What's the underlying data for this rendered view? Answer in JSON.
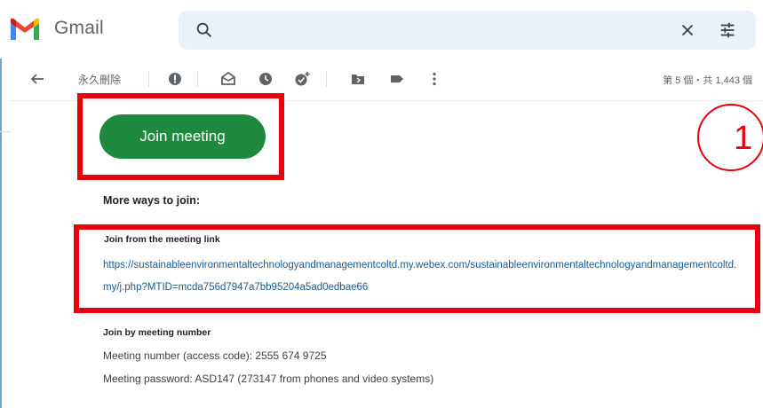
{
  "app": {
    "name": "Gmail"
  },
  "search": {
    "icon": "search-icon",
    "clear_icon": "close-icon",
    "options_icon": "tune-icon"
  },
  "toolbar": {
    "back_icon": "arrow-left-icon",
    "delete_forever_label": "永久刪除",
    "icons": [
      "report-spam-icon",
      "mark-unread-icon",
      "snooze-icon",
      "add-task-icon",
      "move-to-icon",
      "label-icon",
      "more-vert-icon"
    ],
    "count_text": "第 5 個・共 1,443 個"
  },
  "email": {
    "join_button_label": "Join meeting",
    "step_number": "1",
    "more_ways_label": "More ways to join:",
    "link_heading": "Join from the meeting link",
    "meeting_link": "https://sustainableenvironmentaltechnologyandmanagementcoltd.my.webex.com/sustainableenvironmentaltechnologyandmanagementcoltd.my/j.php?MTID=mcda756d7947a7bb95204a5ad0edbae66",
    "number_heading": "Join by meeting number",
    "meeting_number_line": "Meeting number (access code): 2555 674 9725",
    "meeting_password_line": "Meeting password: ASD147 (273147 from phones and video systems)"
  },
  "colors": {
    "highlight_red": "#e8000b",
    "join_green": "#1f8a3f",
    "link_blue": "#1a5c91",
    "search_bg": "#eaf1fb"
  }
}
